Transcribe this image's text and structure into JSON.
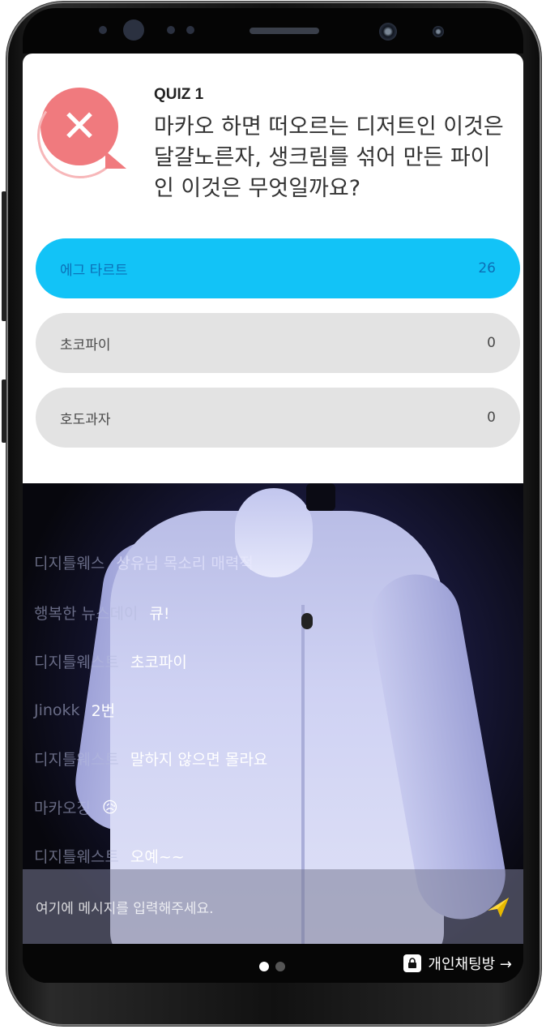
{
  "quiz": {
    "label": "QUIZ 1",
    "question": "마카오 하면 떠오르는 디저트인 이것은 달걀노른자, 생크림를 섞어 만든 파이인 이것은 무엇일까요?",
    "options": [
      {
        "label": "에그 타르트",
        "count": "26"
      },
      {
        "label": "초코파이",
        "count": "0"
      },
      {
        "label": "호도과자",
        "count": "0"
      }
    ],
    "accent": "#12c3f7",
    "wrong_color": "#f07a7e"
  },
  "chat": {
    "messages": [
      {
        "name": "디지틀웨스",
        "msg": "상유님 목소리 매력적"
      },
      {
        "name": "행복한 뉴스데이",
        "msg": "큐!"
      },
      {
        "name": "디지틀웨스트",
        "msg": "초코파이"
      },
      {
        "name": "Jinokk",
        "msg": "2번"
      },
      {
        "name": "디지틀웨스트",
        "msg": "말하지 않으면 몰라요"
      },
      {
        "name": "마카오징",
        "msg": "😥"
      },
      {
        "name": "디지틀웨스트",
        "msg": "오예~~"
      }
    ]
  },
  "input": {
    "placeholder": "여기에 메시지를 입력해주세요."
  },
  "bottom": {
    "private_chat_label": "개인채팅방 →"
  },
  "icons": {
    "wrong": "close-icon",
    "send": "send-icon",
    "lock": "lock-icon"
  }
}
